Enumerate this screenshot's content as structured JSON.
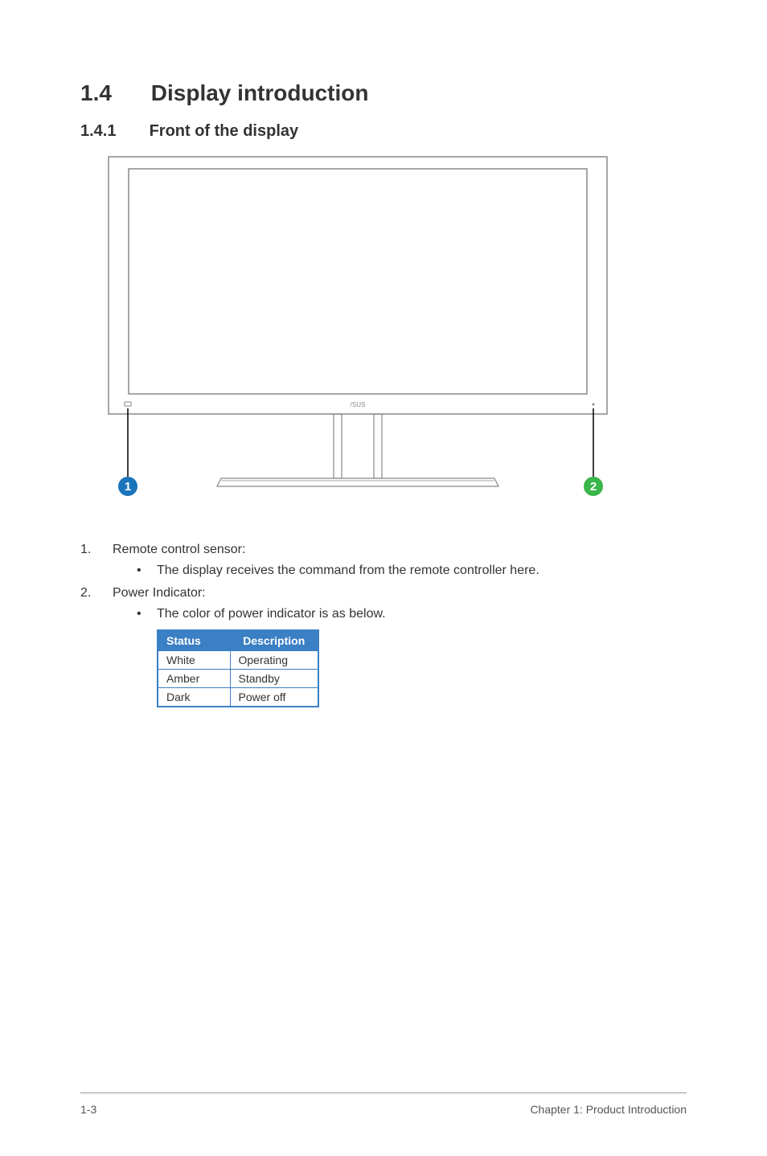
{
  "heading": {
    "number": "1.4",
    "title": "Display introduction"
  },
  "subheading": {
    "number": "1.4.1",
    "title": "Front of the display"
  },
  "callouts": {
    "one": "1",
    "two": "2"
  },
  "items": [
    {
      "num": "1.",
      "label": "Remote control sensor:",
      "bullets": [
        "The display receives the command from the remote controller here."
      ]
    },
    {
      "num": "2.",
      "label": "Power Indicator:",
      "bullets": [
        "The color of power indicator is as below."
      ]
    }
  ],
  "table": {
    "headers": [
      "Status",
      "Description"
    ],
    "rows": [
      [
        "White",
        "Operating"
      ],
      [
        "Amber",
        "Standby"
      ],
      [
        "Dark",
        "Power off"
      ]
    ]
  },
  "footer": {
    "left": "1-3",
    "right": "Chapter 1: Product Introduction"
  }
}
